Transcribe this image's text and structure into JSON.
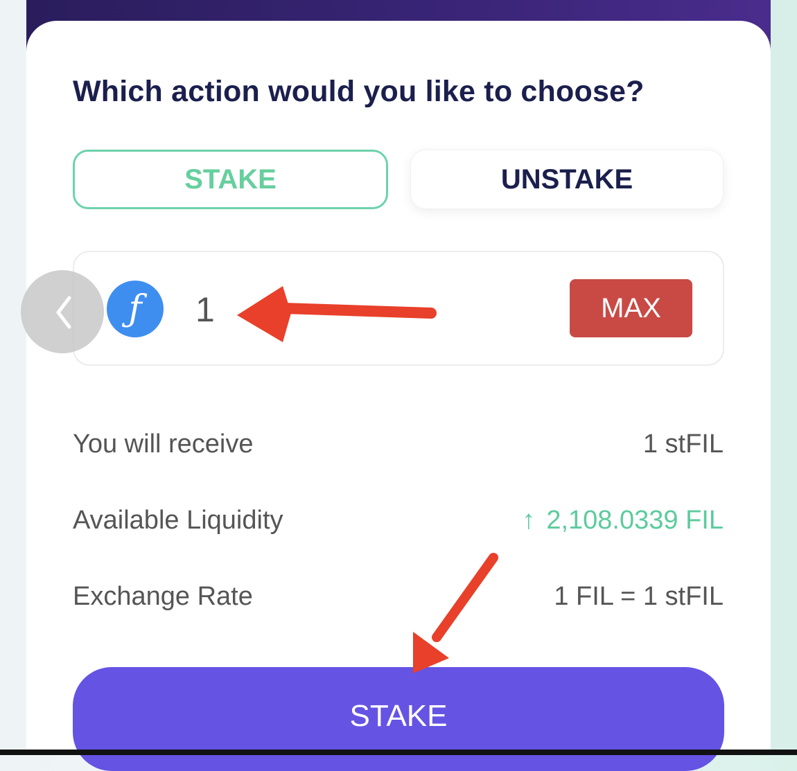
{
  "heading": "Which action would you like to choose?",
  "tabs": {
    "stake_label": "STAKE",
    "unstake_label": "UNSTAKE",
    "selected": "STAKE"
  },
  "amount": {
    "value": "1",
    "token_icon": "filecoin-icon"
  },
  "max_label": "MAX",
  "details": {
    "receive_label": "You will receive",
    "receive_value": "1 stFIL",
    "liquidity_label": "Available Liquidity",
    "liquidity_arrow": "↑",
    "liquidity_value": "2,108.0339 FIL",
    "rate_label": "Exchange Rate",
    "rate_value": "1 FIL = 1 stFIL"
  },
  "submit_label": "STAKE",
  "colors": {
    "accent_green": "#66cf9e",
    "navy": "#1b1f4d",
    "max_red": "#c94a45",
    "primary_purple": "#6553e4",
    "filecoin_blue": "#3e8ef0",
    "annotation_red": "#e8402a"
  }
}
